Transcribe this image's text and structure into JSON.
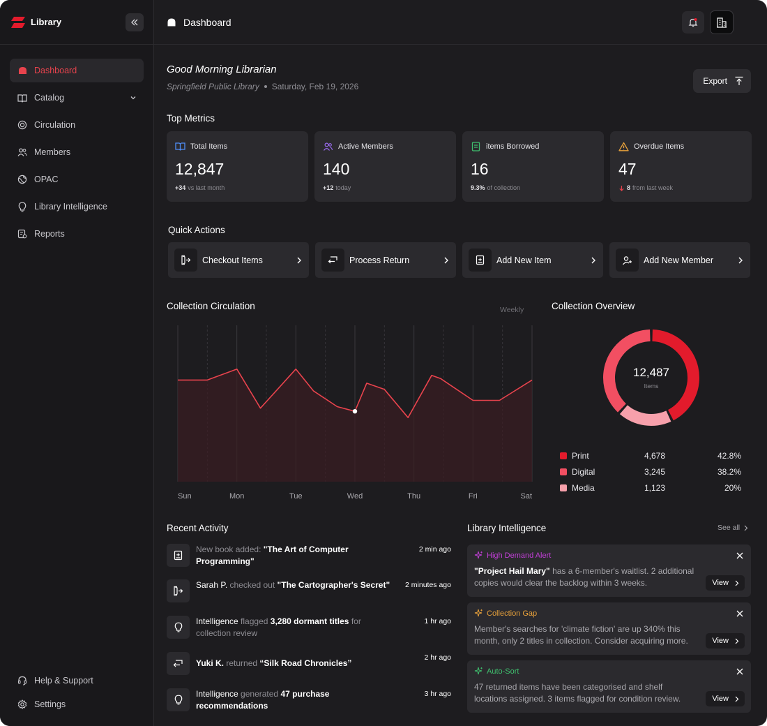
{
  "app": {
    "name": "Library"
  },
  "sidebar": {
    "items": [
      {
        "label": "Dashboard",
        "icon": "home-icon",
        "active": true
      },
      {
        "label": "Catalog",
        "icon": "book-open-icon",
        "expandable": true
      },
      {
        "label": "Circulation",
        "icon": "target-icon"
      },
      {
        "label": "Members",
        "icon": "users-icon"
      },
      {
        "label": "OPAC",
        "icon": "globe-icon"
      },
      {
        "label": "Library Intelligence",
        "icon": "lightbulb-icon"
      },
      {
        "label": "Reports",
        "icon": "report-icon"
      }
    ],
    "footer": [
      {
        "label": "Help & Support",
        "icon": "headset-icon"
      },
      {
        "label": "Settings",
        "icon": "gear-icon"
      }
    ]
  },
  "header": {
    "breadcrumb": "Dashboard"
  },
  "greeting": {
    "title": "Good Morning Librarian",
    "library": "Springfield Public Library",
    "date": "Saturday, Feb 19, 2026",
    "export_label": "Export"
  },
  "metrics": {
    "title": "Top Metrics",
    "cards": [
      {
        "label": "Total Items",
        "value": "12,847",
        "delta": "+34",
        "note": "vs last month",
        "icon": "book-open-icon",
        "color": "#4f8ef7"
      },
      {
        "label": "Active Members",
        "value": "140",
        "delta": "+12",
        "note": "today",
        "icon": "users-icon",
        "color": "#9b6cf2"
      },
      {
        "label": "items Borrowed",
        "value": "16",
        "delta": "9.3%",
        "note": "of collection",
        "icon": "book-icon",
        "color": "#3fbf6e"
      },
      {
        "label": "Overdue Items",
        "value": "47",
        "delta": "8",
        "note": "from last week",
        "icon": "warning-icon",
        "color": "#e9a23b"
      }
    ]
  },
  "quick_actions": {
    "title": "Quick Actions",
    "items": [
      {
        "label": "Checkout Items",
        "icon": "checkout-icon"
      },
      {
        "label": "Process Return",
        "icon": "return-icon"
      },
      {
        "label": "Add New Item",
        "icon": "add-book-icon"
      },
      {
        "label": "Add New Member",
        "icon": "add-user-icon"
      }
    ]
  },
  "circulation": {
    "title": "Collection Circulation",
    "period": "Weekly"
  },
  "chart_data": {
    "type": "area",
    "categories": [
      "Sun",
      "Mon",
      "Tue",
      "Wed",
      "Thu",
      "Fri",
      "Sat"
    ],
    "x": [
      0,
      0.5,
      1,
      1.4,
      2,
      2.3,
      2.7,
      3,
      3.2,
      3.5,
      3.9,
      4.3,
      4.45,
      5,
      5.45,
      6
    ],
    "y": [
      0.65,
      0.65,
      0.72,
      0.47,
      0.72,
      0.58,
      0.48,
      0.45,
      0.63,
      0.59,
      0.41,
      0.68,
      0.66,
      0.52,
      0.52,
      0.65
    ],
    "highlight_index": 7,
    "ylim": [
      0,
      1
    ],
    "line_color": "#e8434d"
  },
  "overview": {
    "title": "Collection Overview",
    "total": "12,487",
    "total_label": "Items",
    "segments": [
      {
        "name": "Print",
        "count": "4,678",
        "percent": "42.8%",
        "share": 0.428,
        "color": "#e31b2c"
      },
      {
        "name": "Digital",
        "count": "3,245",
        "percent": "38.2%",
        "share": 0.382,
        "color": "#f24f62"
      },
      {
        "name": "Media",
        "count": "1,123",
        "percent": "20%",
        "share": 0.19,
        "color": "#f7a0ab"
      }
    ]
  },
  "activity": {
    "title": "Recent Activity",
    "items": [
      {
        "icon": "add-book-icon",
        "pre": "New book added: ",
        "main": "\"The Art of Computer Programming\"",
        "mid": "",
        "tail": "",
        "time": "2 min ago"
      },
      {
        "icon": "checkout-icon",
        "pre": "",
        "main": "Sarah P.",
        "mid": " checked out ",
        "tail": "\"The Cartographer's Secret\"",
        "time": "2 minutes ago"
      },
      {
        "icon": "lightbulb-icon",
        "pre": "",
        "main": "Intelligence",
        "mid": " flagged ",
        "tail": "3,280 dormant titles",
        "after": " for collection review",
        "time": "1 hr ago"
      },
      {
        "icon": "return-icon",
        "pre": "",
        "main": "Yuki K.",
        "mid": " returned ",
        "tail": "“Silk Road Chronicles”",
        "time": "2 hr ago"
      },
      {
        "icon": "lightbulb-icon",
        "pre": "",
        "main": "Intelligence",
        "mid": " generated ",
        "tail": "47 purchase recommendations",
        "time": "3 hr ago"
      }
    ]
  },
  "intelligence": {
    "title": "Library Intelligence",
    "see_all": "See all",
    "view_label": "View",
    "cards": [
      {
        "tag": "High Demand Alert",
        "color": "#c13fd6",
        "bold": "\"Project Hail Mary\"",
        "text": " has a 6-member's waitlist. 2 additional copies would clear the backlog within 3 weeks."
      },
      {
        "tag": "Collection Gap",
        "color": "#e9a23b",
        "bold": "",
        "text": "Member's searches for 'climate fiction' are up 340% this month, only 2 titles in collection. Consider acquiring more."
      },
      {
        "tag": "Auto-Sort",
        "color": "#3fbf6e",
        "bold": "",
        "text": "47 returned items have been categorised and shelf locations assigned. 3 items flagged for condition review."
      }
    ]
  }
}
